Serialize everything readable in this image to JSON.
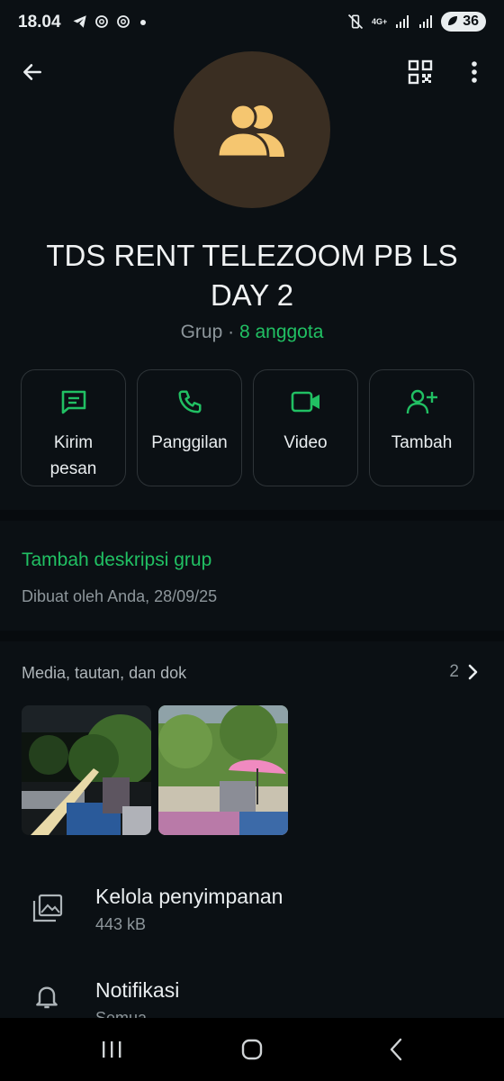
{
  "status_bar": {
    "time": "18.04",
    "left_icons": [
      "telegram-icon",
      "threads-icon",
      "threads-icon",
      "dot-icon"
    ],
    "right_icons": [
      "mute-vibrate-icon",
      "4g-icon",
      "signal-icon",
      "signal-icon"
    ],
    "network": "4G+",
    "battery": "36"
  },
  "header": {
    "back_icon": "back-arrow-icon",
    "qr_icon": "qr-code-icon",
    "menu_icon": "more-vert-icon"
  },
  "group": {
    "avatar_icon": "group-icon",
    "name": "TDS RENT TELEZOOM PB LS DAY 2",
    "type_label": "Grup ·",
    "members": "8 anggota"
  },
  "actions": [
    {
      "label": "Kirim pesan",
      "icon": "message-icon"
    },
    {
      "label": "Panggilan",
      "icon": "phone-icon"
    },
    {
      "label": "Video",
      "icon": "video-icon"
    },
    {
      "label": "Tambah",
      "icon": "add-person-icon"
    }
  ],
  "description": {
    "add_link": "Tambah deskripsi grup",
    "created": "Dibuat oleh Anda, 28/09/25"
  },
  "media": {
    "header": "Media, tautan, dan dok",
    "count": "2"
  },
  "rows": [
    {
      "title": "Kelola penyimpanan",
      "subtitle": "443 kB",
      "icon": "storage-icon"
    },
    {
      "title": "Notifikasi",
      "subtitle": "Semua",
      "icon": "bell-icon"
    }
  ],
  "colors": {
    "accent": "#21c063",
    "background": "#0b1014",
    "avatar_bg": "#3a2e22",
    "avatar_icon": "#f5c670"
  }
}
